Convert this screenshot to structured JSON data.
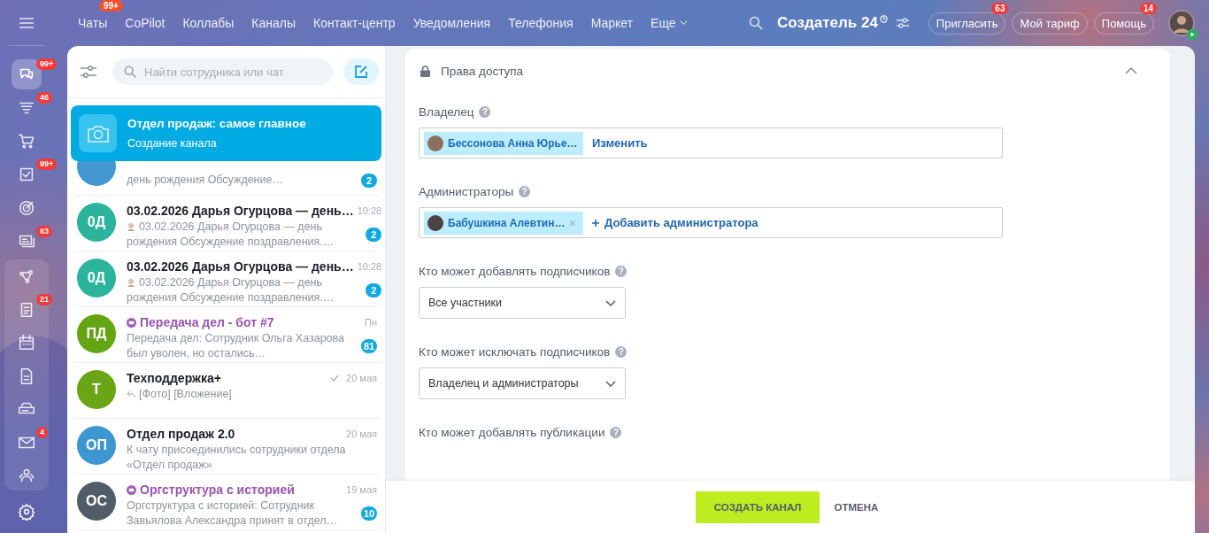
{
  "rail": [
    {
      "kind": "chats",
      "badge": "99+",
      "selected": true
    },
    {
      "kind": "feed",
      "badge": "46",
      "selected": false
    },
    {
      "kind": "cart",
      "selected": false
    },
    {
      "kind": "tasks",
      "badge": "99+",
      "selected": false
    },
    {
      "kind": "target",
      "selected": false
    },
    {
      "kind": "cards",
      "badge": "63",
      "selected": false
    },
    {
      "kind": "flow",
      "selected": false
    },
    {
      "kind": "list",
      "badge": "21",
      "selected": false
    },
    {
      "kind": "calendar",
      "selected": false
    },
    {
      "kind": "doc",
      "selected": false
    },
    {
      "kind": "drive",
      "selected": false
    },
    {
      "kind": "mail",
      "badge": "4",
      "selected": false
    },
    {
      "kind": "people",
      "selected": false
    }
  ],
  "top_nav": {
    "items": [
      {
        "label": "Чаты",
        "badge": "99+"
      },
      {
        "label": "CoPilot"
      },
      {
        "label": "Коллабы"
      },
      {
        "label": "Каналы"
      },
      {
        "label": "Контакт-центр"
      },
      {
        "label": "Уведомления"
      },
      {
        "label": "Телефония"
      },
      {
        "label": "Маркет"
      }
    ],
    "more": "Еще",
    "logo": "Создатель",
    "logo_number": "24",
    "buttons": [
      {
        "label": "Пригласить",
        "badge": "63"
      },
      {
        "label": "Мой тариф"
      },
      {
        "label": "Помощь",
        "badge": "14"
      }
    ]
  },
  "chat_list": {
    "search": {
      "placeholder": "Найти сотрудника или чат"
    },
    "current": {
      "title": "Отдел продаж: самое главное",
      "subtitle": "Создание канала"
    },
    "chats": [
      {
        "color": "#4396cf",
        "preview": "день рождения Обсуждение…",
        "badge": "2"
      },
      {
        "initials": "0Д",
        "color": "#2bb39c",
        "title": "03.02.2026 Дарья Огурцова — день…",
        "time": "10:28",
        "preview": "03.02.2026 Дарья Огурцова — день рождения Обсуждение поздравления.…",
        "author_avatar": true,
        "badge": "2"
      },
      {
        "initials": "0Д",
        "color": "#2bb39c",
        "title": "03.02.2026 Дарья Огурцова — день…",
        "time": "10:28",
        "preview": "03.02.2026 Дарья Огурцова — день рождения Обсуждение поздравления.…",
        "author_avatar": true,
        "badge": "2"
      },
      {
        "initials": "ПД",
        "color": "#64a513",
        "kind": "bot",
        "title": "Передача дел - бот #7",
        "time": "Пн",
        "preview": "Передача дел: Сотрудник Ольга Хазарова был уволен, но остались…",
        "badge": "81"
      },
      {
        "initials": "Т",
        "color": "#6aa516",
        "title": "Техподдержка+",
        "time": "20 мая",
        "read": true,
        "preview": "[Фото] [Вложение]",
        "reply": true
      },
      {
        "initials": "ОП",
        "color": "#3c97d1",
        "title": "Отдел продаж 2.0",
        "time": "20 мая",
        "preview": "К чату присоединились сотрудники отдела «Отдел продаж»"
      },
      {
        "initials": "ОС",
        "color": "#525c69",
        "kind": "bot",
        "title": "Оргструктура с историей",
        "time": "19 мая",
        "preview": "Оргструктура с историей: Сотрудник Завьялова Александра принят в отдел…",
        "badge": "10"
      }
    ]
  },
  "form": {
    "section_title": "Права доступа",
    "expanded": true,
    "help": "?",
    "owner": {
      "label": "Владелец",
      "user": "Бессонова Анна Юрье…",
      "action": "Изменить"
    },
    "admins": {
      "label": "Администраторы",
      "users": [
        {
          "name": "Бабушкина Алевтин…",
          "removable": true
        }
      ],
      "add": "Добавить администратора"
    },
    "selects": [
      {
        "label": "Кто может добавлять подписчиков",
        "value": "Все участники"
      },
      {
        "label": "Кто может исключать подписчиков",
        "value": "Владелец и администраторы"
      }
    ],
    "cut_label": "Кто может добавлять публикации"
  },
  "footer": {
    "primary": "СОЗДАТЬ КАНАЛ",
    "secondary": "ОТМЕНА"
  }
}
